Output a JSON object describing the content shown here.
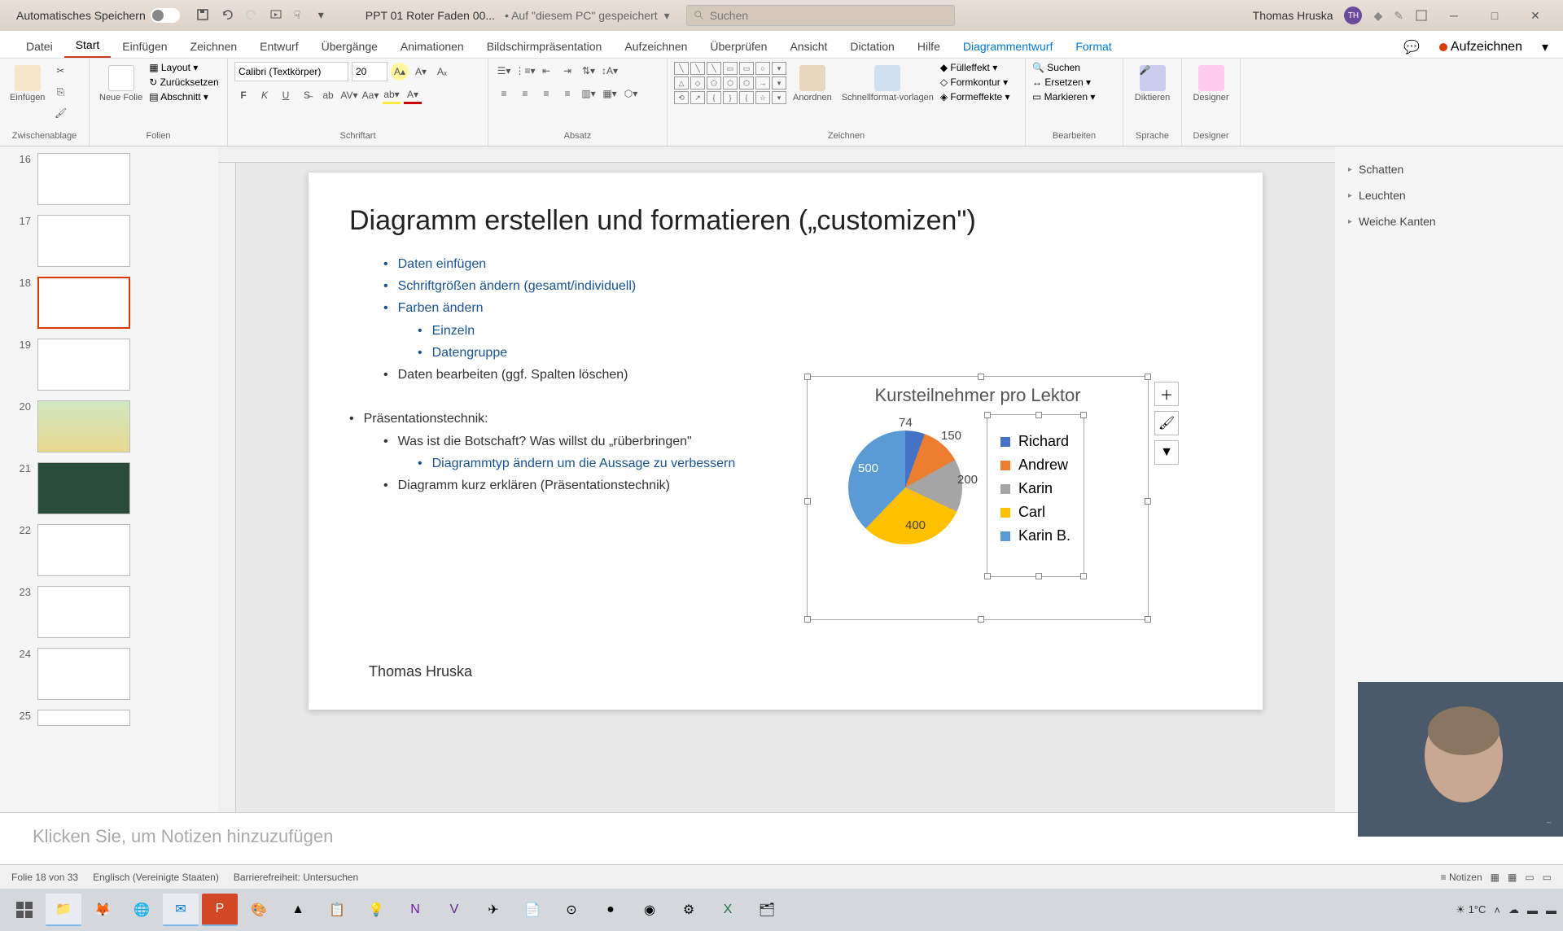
{
  "titlebar": {
    "autosave_label": "Automatisches Speichern",
    "doc_name": "PPT 01 Roter Faden 00...",
    "saved_info": "• Auf \"diesem PC\" gespeichert",
    "search_placeholder": "Suchen",
    "user_name": "Thomas Hruska",
    "user_initials": "TH"
  },
  "tabs": {
    "items": [
      "Datei",
      "Start",
      "Einfügen",
      "Zeichnen",
      "Entwurf",
      "Übergänge",
      "Animationen",
      "Bildschirmpräsentation",
      "Aufzeichnen",
      "Überprüfen",
      "Ansicht",
      "Dictation",
      "Hilfe"
    ],
    "contextual": [
      "Diagrammentwurf",
      "Format"
    ],
    "record": "Aufzeichnen"
  },
  "ribbon": {
    "clipboard": {
      "paste": "Einfügen",
      "label": "Zwischenablage"
    },
    "slides": {
      "new": "Neue Folie",
      "layout": "Layout",
      "reset": "Zurücksetzen",
      "section": "Abschnitt",
      "label": "Folien"
    },
    "font": {
      "name": "Calibri (Textkörper)",
      "size": "20",
      "label": "Schriftart"
    },
    "paragraph": {
      "label": "Absatz"
    },
    "drawing": {
      "arrange": "Anordnen",
      "quickstyles": "Schnellformat-vorlagen",
      "fill": "Fülleffekt",
      "outline": "Formkontur",
      "effects": "Formeffekte",
      "label": "Zeichnen"
    },
    "editing": {
      "find": "Suchen",
      "replace": "Ersetzen",
      "select": "Markieren",
      "label": "Bearbeiten"
    },
    "voice": {
      "dictate": "Diktieren",
      "label": "Sprache"
    },
    "designer": {
      "btn": "Designer",
      "label": "Designer"
    }
  },
  "thumbs": [
    16,
    17,
    18,
    19,
    20,
    21,
    22,
    23,
    24,
    25
  ],
  "active_thumb": 18,
  "slide": {
    "title": "Diagramm erstellen und formatieren („customizen\")",
    "b1": "Daten einfügen",
    "b2": "Schriftgrößen ändern (gesamt/individuell)",
    "b3": "Farben ändern",
    "b3a": "Einzeln",
    "b3b": "Datengruppe",
    "b4": "Daten bearbeiten (ggf. Spalten löschen)",
    "b5": "Präsentationstechnik:",
    "b5a": "Was ist die Botschaft? Was willst du „rüberbringen\"",
    "b5a1": "Diagrammtyp ändern um die Aussage zu verbessern",
    "b5b": "Diagramm kurz erklären (Präsentationstechnik)",
    "author": "Thomas Hruska"
  },
  "chart_data": {
    "type": "pie",
    "title": "Kursteilnehmer pro Lektor",
    "series": [
      {
        "name": "Richard",
        "value": 74,
        "color": "#4472c4"
      },
      {
        "name": "Andrew",
        "value": 150,
        "color": "#ed7d31"
      },
      {
        "name": "Karin",
        "value": 200,
        "color": "#a5a5a5"
      },
      {
        "name": "Carl",
        "value": 400,
        "color": "#ffc000"
      },
      {
        "name": "Karin B.",
        "value": 500,
        "color": "#5b9bd5"
      }
    ]
  },
  "right_pane": {
    "i1": "Schatten",
    "i2": "Leuchten",
    "i3": "Weiche Kanten"
  },
  "notes": {
    "placeholder": "Klicken Sie, um Notizen hinzuzufügen"
  },
  "status": {
    "slide": "Folie 18 von 33",
    "lang": "Englisch (Vereinigte Staaten)",
    "access": "Barrierefreiheit: Untersuchen",
    "notes": "Notizen"
  },
  "tray": {
    "weather": "1°C"
  }
}
